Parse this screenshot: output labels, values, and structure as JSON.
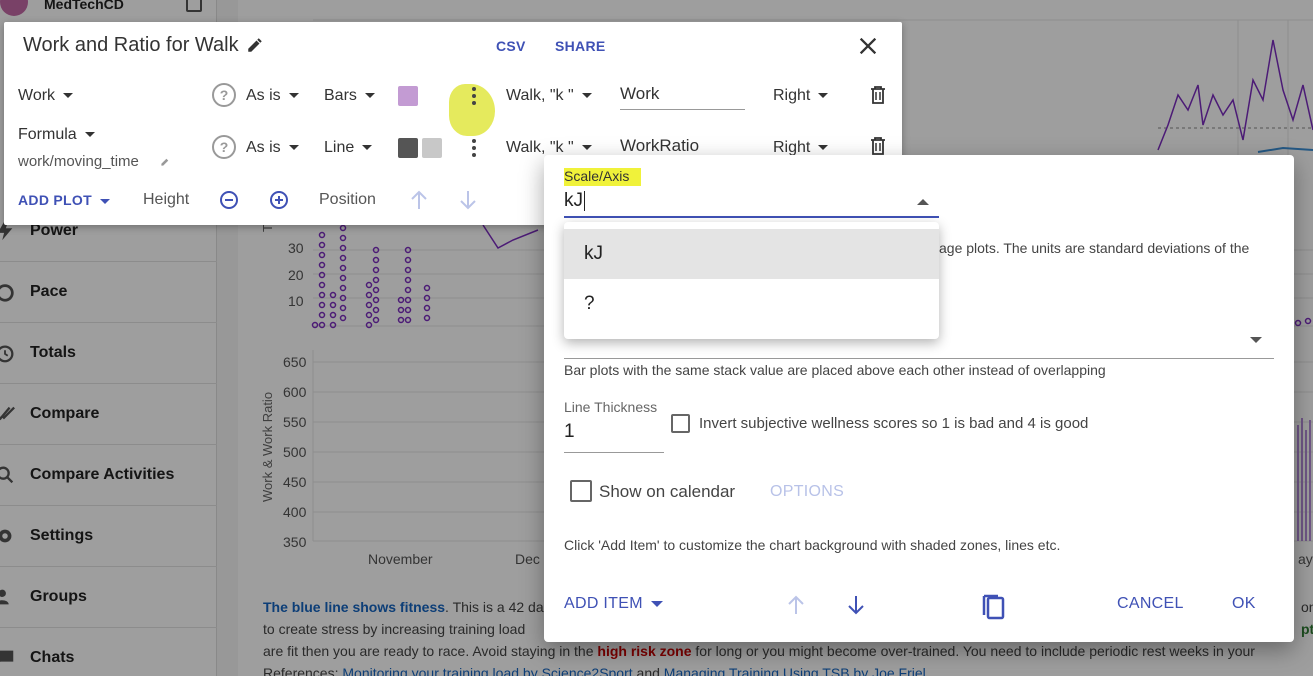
{
  "app": {
    "user_name": "MedTechCD"
  },
  "sidebar": {
    "items": [
      {
        "label": "Power",
        "icon": "bolt-icon"
      },
      {
        "label": "Pace",
        "icon": "stopwatch-icon"
      },
      {
        "label": "Totals",
        "icon": "timer-icon"
      },
      {
        "label": "Compare",
        "icon": "double-check-icon"
      },
      {
        "label": "Compare Activities",
        "icon": "search-icon"
      },
      {
        "label": "Settings",
        "icon": "gear-icon"
      },
      {
        "label": "Groups",
        "icon": "people-icon"
      },
      {
        "label": "Chats",
        "icon": "chat-icon"
      }
    ]
  },
  "chart": {
    "y_labels": [
      "650",
      "600",
      "550",
      "500",
      "450",
      "400",
      "350"
    ],
    "upper_y_labels": [
      "30",
      "20",
      "10"
    ],
    "x_labels": [
      "November",
      "Dec"
    ],
    "x_label_right": "ay",
    "y_axis_title": "Work & Work Ratio",
    "upper_axis_stub": "Tra"
  },
  "info": {
    "blue_text": "The blue line shows fitness",
    "line1": ". This is a 42 da",
    "line1_right": "one",
    "line2": "to create stress by increasing training load",
    "line2_right": "pti",
    "line3_a": "are fit then you are ready to race. Avoid staying in the ",
    "risk": "high risk zone",
    "line3_b": " for long or you might become over-trained. You need to include periodic rest weeks in your",
    "refs_prefix": "References: ",
    "ref1": "Monitoring your training load by Science2Sport",
    "refs_and": " and ",
    "ref2": "Managing Training Using TSB by Joe Friel"
  },
  "panel": {
    "title": "Work and Ratio for Walk",
    "csv": "CSV",
    "share": "SHARE",
    "rows": [
      {
        "field": "Work",
        "help": "?",
        "mode": "As is",
        "type": "Bars",
        "scale": "Walk, \"k \"",
        "name": "Work",
        "side": "Right",
        "color": "#c39bd3"
      },
      {
        "field": "Formula",
        "formula": "work/moving_time",
        "help": "?",
        "mode": "As is",
        "type": "Line",
        "scale": "Walk, \"k \"",
        "name": "WorkRatio",
        "side": "Right",
        "color": "#555555",
        "color2": "#c8c8c8"
      }
    ],
    "add_plot": "ADD PLOT",
    "height": "Height",
    "position": "Position"
  },
  "dialog": {
    "scale_label": "Scale/Axis",
    "scale_value": "kJ",
    "partial_text": "age plots. The units are standard deviations of the",
    "stack_help": "Bar plots with the same stack value are placed above each other instead of overlapping",
    "line_thickness_label": "Line Thickness",
    "line_thickness_value": "1",
    "invert_label": "Invert subjective wellness scores so 1 is bad and 4 is good",
    "show_calendar_label": "Show on calendar",
    "options": "OPTIONS",
    "bg_help": "Click 'Add Item' to customize the chart background with shaded zones, lines etc.",
    "add_item": "ADD ITEM",
    "cancel": "CANCEL",
    "ok": "OK"
  },
  "menu": {
    "items": [
      "kJ",
      "?"
    ]
  }
}
